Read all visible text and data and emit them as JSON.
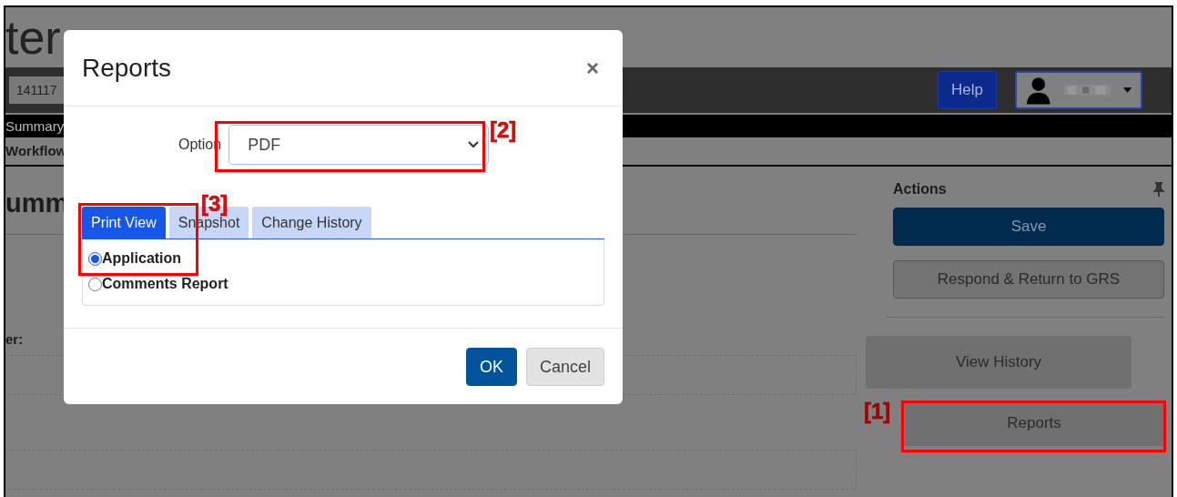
{
  "background": {
    "title": "ter",
    "case_number": "141117",
    "help_button": "Help",
    "nav_item": "Summary",
    "subnav_item": "Workflow",
    "heading": "umm",
    "field_label": "er:",
    "actions": {
      "title": "Actions",
      "buttons": [
        {
          "label": "Save",
          "kind": "primary"
        },
        {
          "label": "Respond & Return to GRS",
          "kind": "secondary"
        }
      ],
      "more_buttons": [
        {
          "label": "View History"
        },
        {
          "label": "Reports"
        }
      ]
    }
  },
  "dialog": {
    "title": "Reports",
    "close": "×",
    "option_label": "Option",
    "option_value": "PDF",
    "tabs": [
      {
        "label": "Print View",
        "selected": true
      },
      {
        "label": "Snapshot",
        "selected": false
      },
      {
        "label": "Change History",
        "selected": false
      }
    ],
    "choices": [
      {
        "label": "Application",
        "selected": true
      },
      {
        "label": "Comments Report",
        "selected": false
      }
    ],
    "buttons": [
      {
        "label": "OK",
        "kind": "primary"
      },
      {
        "label": "Cancel",
        "kind": "secondary"
      }
    ]
  },
  "callouts": [
    {
      "label": "[1]"
    },
    {
      "label": "[2]"
    },
    {
      "label": "[3]"
    }
  ]
}
